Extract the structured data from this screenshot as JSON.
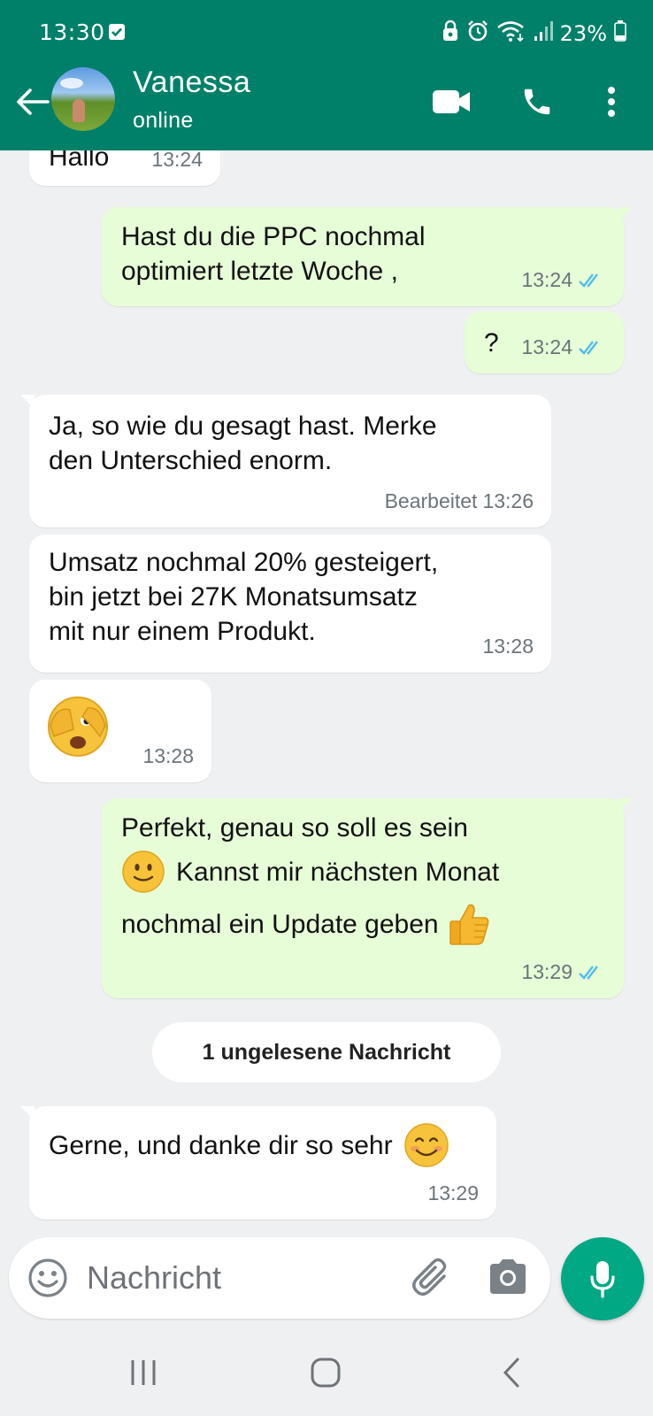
{
  "status_bar": {
    "time": "13:30",
    "battery": "23%"
  },
  "header": {
    "contact_name": "Vanessa",
    "contact_status": "online"
  },
  "messages": [
    {
      "dir": "in",
      "text": "Hallo",
      "time": "13:24"
    },
    {
      "dir": "out",
      "text": "Hast du die PPC nochmal\noptimiert letzte Woche ,",
      "time": "13:24",
      "status": "read"
    },
    {
      "dir": "out",
      "text": "?",
      "time": "13:24",
      "status": "read"
    },
    {
      "dir": "in",
      "text": "Ja, so wie du gesagt hast. Merke\nden Unterschied enorm.",
      "edited_label": "Bearbeitet",
      "time": "13:26"
    },
    {
      "dir": "in",
      "text": "Umsatz nochmal 20% gesteigert,\nbin jetzt bei 27K Monatsumsatz\nmit nur einem Produkt.",
      "time": "13:28"
    },
    {
      "dir": "in",
      "emoji": "face-peeking-icon",
      "time": "13:28"
    },
    {
      "dir": "out",
      "text_line1": "Perfekt, genau so soll es sein",
      "text_line2": "Kannst mir nächsten Monat",
      "text_line3": "nochmal ein Update geben",
      "time": "13:29",
      "status": "read"
    },
    {
      "dir": "in",
      "text": "Gerne, und danke dir so sehr",
      "time": "13:29"
    }
  ],
  "unread_divider": "1 ungelesene Nachricht",
  "composer": {
    "placeholder": "Nachricht"
  },
  "colors": {
    "header": "#008069",
    "outgoing_bubble": "#e7fdd7",
    "incoming_bubble": "#ffffff",
    "read_ticks": "#53bdeb",
    "mic_button": "#00a884"
  }
}
